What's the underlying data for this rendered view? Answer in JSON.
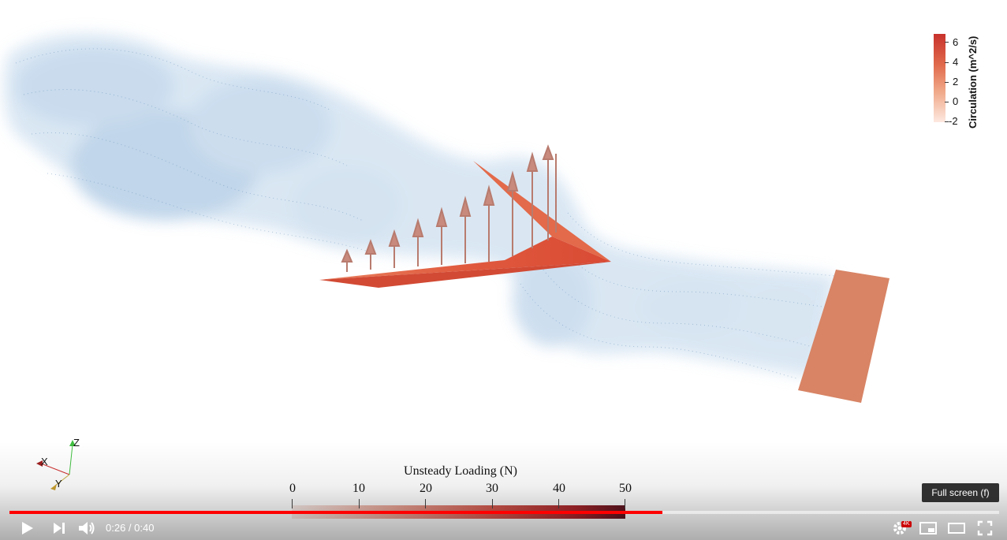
{
  "colors": {
    "accent": "#ff0000",
    "wake": "#4a86bf",
    "wing": "#d9533a",
    "plate": "#d9866a"
  },
  "circulation_legend": {
    "title": "Circulation (m^2/s)",
    "ticks": [
      "6",
      "4",
      "2",
      "0",
      "-2"
    ]
  },
  "loading_legend": {
    "title": "Unsteady Loading (N)",
    "ticks": [
      "0",
      "10",
      "20",
      "30",
      "40",
      "50"
    ]
  },
  "axes_triad": {
    "x": "X",
    "y": "Y",
    "z": "Z"
  },
  "player": {
    "current_time": "0:26",
    "duration": "0:40",
    "time_separator": " / ",
    "progress_fraction": 0.66,
    "buffered_fraction": 0.66,
    "quality_badge": "4K",
    "tooltip": "Full screen (f)",
    "buttons": {
      "play": "play-icon",
      "next": "skip-next-icon",
      "volume": "volume-icon",
      "settings": "gear-icon",
      "miniplayer": "miniplayer-icon",
      "theater": "theater-icon",
      "fullscreen": "fullscreen-icon"
    }
  }
}
